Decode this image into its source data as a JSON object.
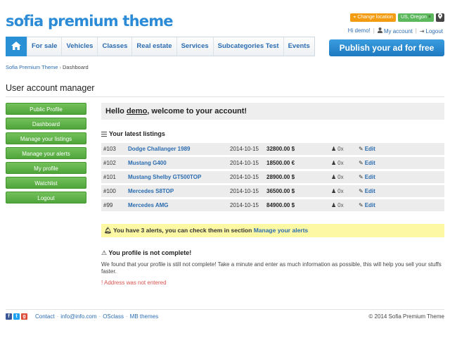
{
  "header": {
    "logo": "sofia premium theme",
    "change_location": "Change location",
    "current_location": "US, Oregon",
    "location_clear": "×",
    "user_greeting": "Hi demo!",
    "my_account": "My account",
    "logout": "Logout"
  },
  "nav": {
    "items": [
      "For sale",
      "Vehicles",
      "Classes",
      "Real estate",
      "Services",
      "Subcategories Test",
      "Events"
    ]
  },
  "publish_button": "Publish your ad for free",
  "breadcrumb": {
    "home": "Sofia Premium Theme",
    "separator": "›",
    "current": "Dashboard"
  },
  "page_title": "User account manager",
  "sidebar": {
    "items": [
      "Public Profile",
      "Dashboard",
      "Manage your listings",
      "Manage your alerts",
      "My profile",
      "Watchlist",
      "Logout"
    ]
  },
  "welcome": {
    "prefix": "Hello ",
    "username": "demo",
    "suffix": ", welcome to your account!"
  },
  "listings": {
    "title": "Your latest listings",
    "edit_label": "Edit",
    "rows": [
      {
        "id": "#103",
        "title": "Dodge Challanger 1989",
        "date": "2014-10-15",
        "price": "32800.00 $",
        "views": "0x"
      },
      {
        "id": "#102",
        "title": "Mustang G400",
        "date": "2014-10-15",
        "price": "18500.00 €",
        "views": "0x"
      },
      {
        "id": "#101",
        "title": "Mustang Shelby GT500TOP",
        "date": "2014-10-15",
        "price": "28900.00 $",
        "views": "0x"
      },
      {
        "id": "#100",
        "title": "Mercedes S8TOP",
        "date": "2014-10-15",
        "price": "36500.00 $",
        "views": "0x"
      },
      {
        "id": "#99",
        "title": "Mercedes AMG",
        "date": "2014-10-15",
        "price": "84900.00 $",
        "views": "0x"
      }
    ]
  },
  "alerts": {
    "text": "You have 3 alerts, you can check them in section ",
    "link": "Manage your alerts"
  },
  "profile_notice": {
    "title": "You profile is not complete!",
    "text": "We found that your profile is still not complete! Take a minute and enter as much information as possible, this will help you sell your stuffs faster.",
    "warning": "Address was not entered"
  },
  "footer": {
    "links": [
      "Contact",
      "info@info.com",
      "OSclass",
      "MB themes"
    ],
    "copyright": "© 2014 Sofia Premium Theme"
  },
  "colors": {
    "brand_blue": "#2b8bd6",
    "sidebar_green": "#5cb346",
    "alert_yellow": "#fcf8a4",
    "location_orange": "#f39c12",
    "warning_red": "#d9534f"
  }
}
